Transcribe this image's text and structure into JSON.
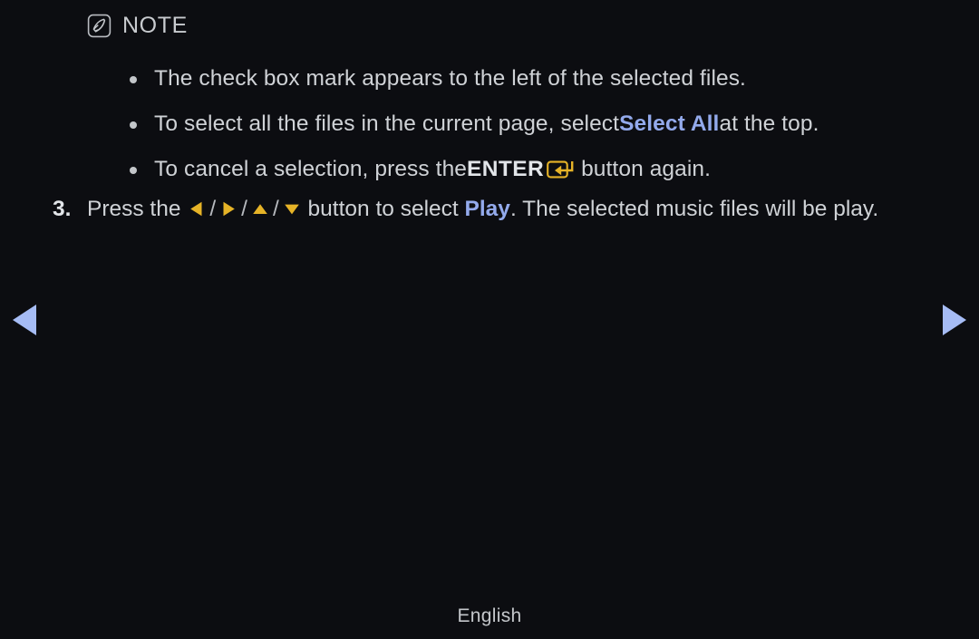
{
  "page": {
    "background_color": "#0c0d11",
    "text_color": "#cfd2d6",
    "accent_blue": "#93aaec",
    "accent_gold": "#e6b327"
  },
  "note": {
    "icon": "note-pencil-icon",
    "label": "NOTE",
    "bullets": [
      {
        "segments": [
          {
            "text": "The check box mark appears to the left of the selected files.",
            "style": "normal"
          }
        ]
      },
      {
        "segments": [
          {
            "text": "To select all the files in the current page, select ",
            "style": "normal"
          },
          {
            "text": "Select All",
            "style": "blue-bold"
          },
          {
            "text": " at the top.",
            "style": "normal"
          }
        ]
      },
      {
        "segments": [
          {
            "text": "To cancel a selection, press the ",
            "style": "normal"
          },
          {
            "text": "ENTER",
            "style": "bold"
          },
          {
            "text": "enter-key-icon",
            "style": "icon-enter"
          },
          {
            "text": "button again.",
            "style": "normal"
          }
        ]
      }
    ]
  },
  "step": {
    "number": "3.",
    "segments": [
      {
        "text": "Press the ",
        "style": "normal"
      },
      {
        "text": "arrow-left-icon",
        "style": "icon-arrow-left"
      },
      {
        "text": "/",
        "style": "slash"
      },
      {
        "text": "arrow-right-icon",
        "style": "icon-arrow-right"
      },
      {
        "text": "/",
        "style": "slash"
      },
      {
        "text": "arrow-up-icon",
        "style": "icon-arrow-up"
      },
      {
        "text": "/",
        "style": "slash"
      },
      {
        "text": "arrow-down-icon",
        "style": "icon-arrow-down"
      },
      {
        "text": " button to select ",
        "style": "normal"
      },
      {
        "text": "Play",
        "style": "blue-bold"
      },
      {
        "text": ". The selected music files will be play.",
        "style": "normal"
      }
    ]
  },
  "navigation": {
    "previous_label": "previous-page-arrow",
    "next_label": "next-page-arrow",
    "arrow_color": "#a6bcf5"
  },
  "footer": {
    "language": "English"
  }
}
